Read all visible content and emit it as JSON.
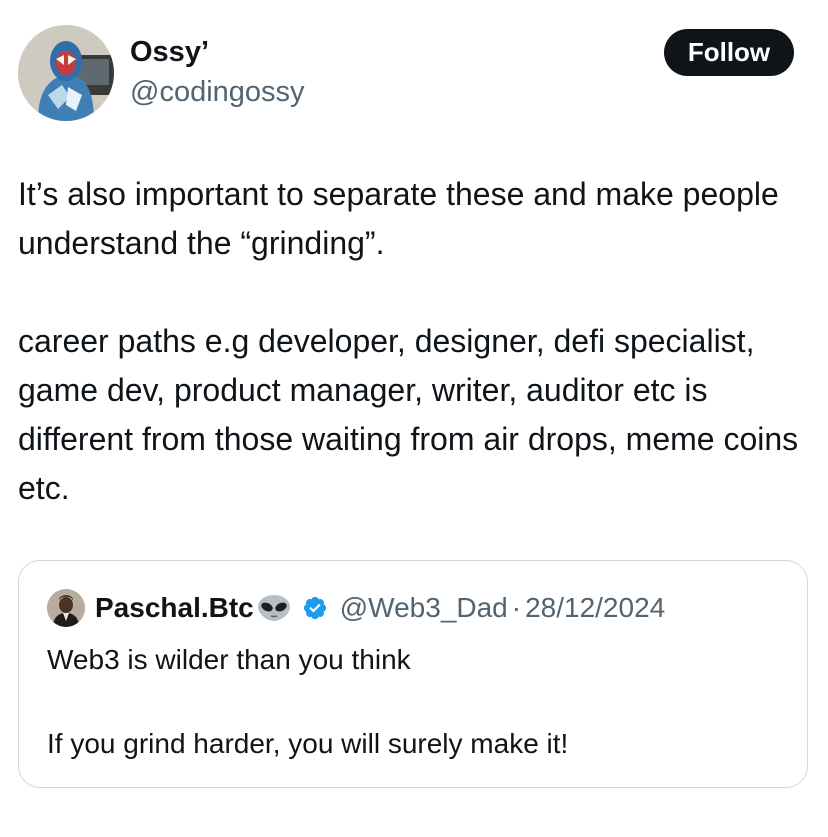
{
  "author": {
    "display_name": "Ossy’",
    "handle": "@codingossy",
    "avatar_icon": "user-avatar-photo"
  },
  "follow_button": {
    "label": "Follow",
    "bg_color": "#0f1419",
    "text_color": "#ffffff"
  },
  "tweet": {
    "paragraphs": [
      "It’s also important to separate these and make people understand the “grinding”.",
      "career paths e.g developer, designer, defi specialist, game dev, product manager, writer, auditor etc is different from those waiting from air drops, meme coins etc."
    ]
  },
  "quoted_tweet": {
    "author_name": "Paschal.Btc",
    "name_emoji": "alien-icon",
    "verified_icon": "verified-badge-icon",
    "handle": "@Web3_Dad",
    "separator": "·",
    "date": "28/12/2024",
    "paragraphs": [
      "Web3 is wilder than you think",
      "If you grind harder, you will surely make it!"
    ]
  },
  "colors": {
    "text_primary": "#0f1419",
    "text_secondary": "#536471",
    "border": "#cfd9de",
    "verified_blue": "#1d9bf0"
  }
}
